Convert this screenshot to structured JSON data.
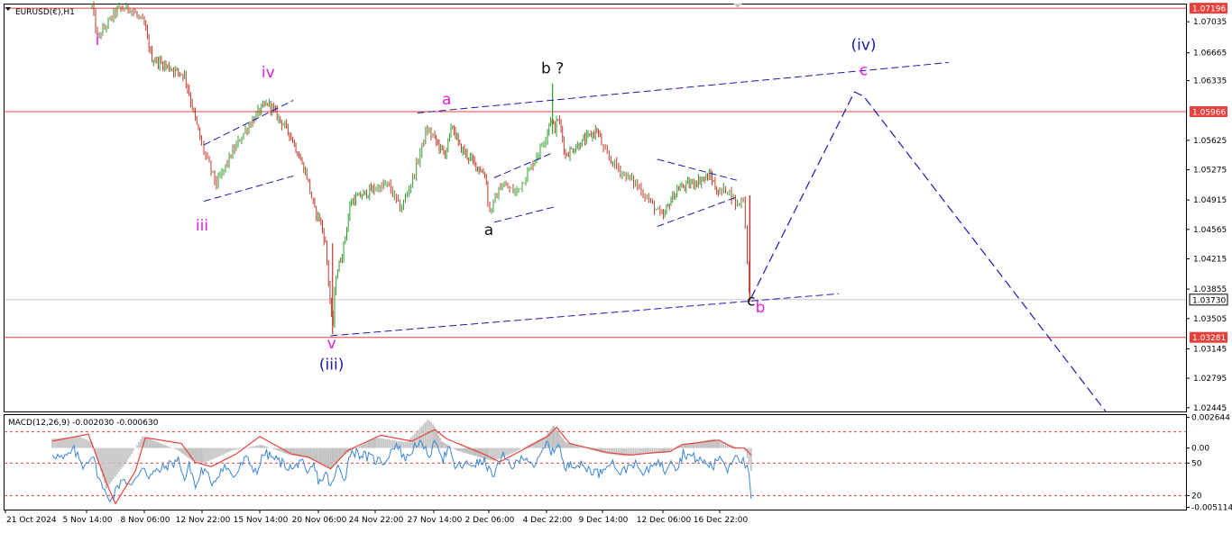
{
  "chart_data": [
    {
      "type": "candlestick",
      "title": "EURUSD(€),H1",
      "symbol": "EURUSD",
      "timeframe": "H1",
      "ylim": [
        1.024,
        1.0724
      ],
      "y_ticks": [
        "1.07035",
        "1.06665",
        "1.06335",
        "1.05625",
        "1.05275",
        "1.04915",
        "1.04565",
        "1.04215",
        "1.03855",
        "1.03505",
        "1.03145",
        "1.02795",
        "1.02445"
      ],
      "x_ticks": [
        "21 Oct 2024",
        "5 Nov 14:00",
        "8 Nov 06:00",
        "12 Nov 22:00",
        "15 Nov 14:00",
        "20 Nov 06:00",
        "24 Nov 22:00",
        "27 Nov 14:00",
        "2 Dec 06:00",
        "4 Dec 22:00",
        "9 Dec 14:00",
        "12 Dec 06:00",
        "16 Dec 22:00"
      ],
      "price_path": [
        {
          "x": "5 Nov 20:00",
          "y": 1.0722
        },
        {
          "x": "6 Nov 02:00",
          "y": 1.0684
        },
        {
          "x": "7 Nov 00:00",
          "y": 1.0718
        },
        {
          "x": "7 Nov 14:00",
          "y": 1.072
        },
        {
          "x": "8 Nov 06:00",
          "y": 1.07
        },
        {
          "x": "8 Nov 20:00",
          "y": 1.066
        },
        {
          "x": "11 Nov 12:00",
          "y": 1.064
        },
        {
          "x": "12 Nov 04:00",
          "y": 1.06
        },
        {
          "x": "12 Nov 22:00",
          "y": 1.0555
        },
        {
          "x": "13 Nov 14:00",
          "y": 1.051
        },
        {
          "x": "14 Nov 06:00",
          "y": 1.0545
        },
        {
          "x": "14 Nov 22:00",
          "y": 1.0575
        },
        {
          "x": "15 Nov 14:00",
          "y": 1.0598
        },
        {
          "x": "16 Nov 06:00",
          "y": 1.0607
        },
        {
          "x": "18 Nov 00:00",
          "y": 1.057
        },
        {
          "x": "18 Nov 16:00",
          "y": 1.0545
        },
        {
          "x": "19 Nov 08:00",
          "y": 1.052
        },
        {
          "x": "19 Nov 22:00",
          "y": 1.048
        },
        {
          "x": "20 Nov 08:00",
          "y": 1.047
        },
        {
          "x": "20 Nov 20:00",
          "y": 1.044
        },
        {
          "x": "21 Nov 10:00",
          "y": 1.0335
        },
        {
          "x": "21 Nov 16:00",
          "y": 1.04
        },
        {
          "x": "22 Nov 06:00",
          "y": 1.043
        },
        {
          "x": "22 Nov 22:00",
          "y": 1.049
        },
        {
          "x": "25 Nov 12:00",
          "y": 1.051
        },
        {
          "x": "26 Nov 02:00",
          "y": 1.048
        },
        {
          "x": "26 Nov 16:00",
          "y": 1.052
        },
        {
          "x": "27 Nov 06:00",
          "y": 1.0575
        },
        {
          "x": "27 Nov 20:00",
          "y": 1.056
        },
        {
          "x": "28 Nov 12:00",
          "y": 1.0545
        },
        {
          "x": "29 Nov 04:00",
          "y": 1.058
        },
        {
          "x": "29 Nov 18:00",
          "y": 1.0555
        },
        {
          "x": "2 Dec 00:00",
          "y": 1.052
        },
        {
          "x": "2 Dec 06:00",
          "y": 1.0475
        },
        {
          "x": "2 Dec 20:00",
          "y": 1.051
        },
        {
          "x": "3 Dec 12:00",
          "y": 1.05
        },
        {
          "x": "4 Dec 02:00",
          "y": 1.0525
        },
        {
          "x": "4 Dec 16:00",
          "y": 1.0555
        },
        {
          "x": "5 Dec 06:00",
          "y": 1.059
        },
        {
          "x": "5 Dec 14:00",
          "y": 1.0575
        },
        {
          "x": "5 Dec 22:00",
          "y": 1.059
        },
        {
          "x": "6 Dec 12:00",
          "y": 1.0545
        },
        {
          "x": "9 Dec 04:00",
          "y": 1.0575
        },
        {
          "x": "9 Dec 18:00",
          "y": 1.0545
        },
        {
          "x": "10 Dec 10:00",
          "y": 1.0525
        },
        {
          "x": "11 Dec 02:00",
          "y": 1.051
        },
        {
          "x": "11 Dec 16:00",
          "y": 1.049
        },
        {
          "x": "12 Dec 06:00",
          "y": 1.047
        },
        {
          "x": "12 Dec 20:00",
          "y": 1.049
        },
        {
          "x": "13 Dec 12:00",
          "y": 1.0505
        },
        {
          "x": "16 Dec 04:00",
          "y": 1.052
        },
        {
          "x": "16 Dec 18:00",
          "y": 1.05
        },
        {
          "x": "17 Dec 10:00",
          "y": 1.0505
        },
        {
          "x": "18 Dec 00:00",
          "y": 1.0485
        },
        {
          "x": "18 Dec 10:00",
          "y": 1.0495
        },
        {
          "x": "18 Dec 20:00",
          "y": 1.0373
        }
      ],
      "horizontal_levels": [
        {
          "price": 1.07196,
          "label": "1.07196",
          "color": "#e8413c"
        },
        {
          "price": 1.05966,
          "label": "1.05966",
          "color": "#e8413c"
        },
        {
          "price": 1.03281,
          "label": "1.03281",
          "color": "#e8413c"
        }
      ],
      "current_price": {
        "price": 1.0373,
        "label": "1.03730"
      },
      "trendlines": [
        {
          "from": [
            "21 Nov 06:00",
            1.033
          ],
          "to": [
            "24 Dec 12:00",
            1.038
          ]
        },
        {
          "from": [
            "26 Nov 20:00",
            1.0595
          ],
          "to": [
            "31 Dec 12:00",
            1.0655
          ]
        },
        {
          "from": [
            "13 Nov 00:00",
            1.0557
          ],
          "to": [
            "18 Nov 06:00",
            1.061
          ]
        },
        {
          "from": [
            "13 Nov 00:00",
            1.049
          ],
          "to": [
            "18 Nov 06:00",
            1.052
          ]
        },
        {
          "from": [
            "2 Dec 12:00",
            1.0518
          ],
          "to": [
            "5 Dec 12:00",
            1.0548
          ]
        },
        {
          "from": [
            "2 Dec 12:00",
            1.0465
          ],
          "to": [
            "5 Dec 12:00",
            1.0483
          ]
        },
        {
          "from": [
            "12 Dec 00:00",
            1.054
          ],
          "to": [
            "18 Dec 00:00",
            1.0515
          ]
        },
        {
          "from": [
            "12 Dec 00:00",
            1.046
          ],
          "to": [
            "18 Dec 00:00",
            1.0495
          ]
        }
      ],
      "projection": [
        {
          "x": "18 Dec 22:00",
          "y": 1.0375
        },
        {
          "x": "25 Dec 12:00",
          "y": 1.062
        },
        {
          "x": "26 Dec 02:00",
          "y": 1.0615
        },
        {
          "x": "10 Jan 12:00",
          "y": 1.024
        }
      ],
      "wave_labels": [
        {
          "text": "i",
          "x": "6 Nov 02:00",
          "y": 1.0676,
          "color": "#e81ee3"
        },
        {
          "text": "iii",
          "x": "12 Nov 22:00",
          "y": 1.0455,
          "color": "#e81ee3"
        },
        {
          "text": "iv",
          "x": "16 Nov 06:00",
          "y": 1.0637,
          "color": "#e81ee3"
        },
        {
          "text": "v",
          "x": "21 Nov 08:00",
          "y": 1.0315,
          "color": "#e81ee3"
        },
        {
          "text": "(iii)",
          "x": "21 Nov 08:00",
          "y": 1.029,
          "color": "#1919b4"
        },
        {
          "text": "a",
          "x": "28 Nov 16:00",
          "y": 1.0605,
          "color": "#e81ee3"
        },
        {
          "text": "a",
          "x": "2 Dec 06:00",
          "y": 1.045,
          "color": "#111111"
        },
        {
          "text": "b ?",
          "x": "5 Dec 10:00",
          "y": 1.0642,
          "color": "#111111"
        },
        {
          "text": "c",
          "x": "18 Dec 22:00",
          "y": 1.0366,
          "color": "#111111"
        },
        {
          "text": "b",
          "x": "19 Dec 12:00",
          "y": 1.0358,
          "color": "#e81ee3"
        },
        {
          "text": "(iv)",
          "x": "26 Dec 02:00",
          "y": 1.067,
          "color": "#1919b4"
        },
        {
          "text": "c",
          "x": "26 Dec 02:00",
          "y": 1.064,
          "color": "#e81ee3"
        }
      ]
    },
    {
      "type": "indicator",
      "title": "MACD(12,26,9) -0.002030 -0.000630",
      "name": "MACD(12,26,9)",
      "values_text": "-0.002030 -0.000630",
      "ylim": [
        -0.00531,
        0.00285
      ],
      "y_ticks": [
        {
          "label": "0.002644",
          "v": 0.002644
        },
        {
          "label": "0.00",
          "v": 0.0
        },
        {
          "label": "50",
          "v": -0.0013
        },
        {
          "label": "20",
          "v": -0.0041
        },
        {
          "label": "-0.005114",
          "v": -0.005114
        }
      ],
      "levels": [
        0.0014,
        -0.0013,
        -0.0041
      ],
      "histogram": [
        {
          "x": "4 Nov 00:00",
          "y": 0.0008
        },
        {
          "x": "5 Nov 06:00",
          "y": 0.001
        },
        {
          "x": "5 Nov 20:00",
          "y": 0.0005
        },
        {
          "x": "6 Nov 12:00",
          "y": -0.0035
        },
        {
          "x": "7 Nov 12:00",
          "y": -0.001
        },
        {
          "x": "8 Nov 04:00",
          "y": 0.001
        },
        {
          "x": "11 Nov 00:00",
          "y": -0.0002
        },
        {
          "x": "12 Nov 00:00",
          "y": -0.001
        },
        {
          "x": "13 Nov 00:00",
          "y": -0.0013
        },
        {
          "x": "14 Nov 08:00",
          "y": -0.0002
        },
        {
          "x": "15 Nov 16:00",
          "y": 0.0003
        },
        {
          "x": "18 Nov 00:00",
          "y": -0.0006
        },
        {
          "x": "19 Nov 08:00",
          "y": -0.0008
        },
        {
          "x": "21 Nov 06:00",
          "y": -0.0018
        },
        {
          "x": "22 Nov 06:00",
          "y": -0.0006
        },
        {
          "x": "25 Nov 00:00",
          "y": 0.0009
        },
        {
          "x": "26 Nov 08:00",
          "y": 0.0005
        },
        {
          "x": "27 Nov 08:00",
          "y": 0.0025
        },
        {
          "x": "28 Nov 06:00",
          "y": 0.0006
        },
        {
          "x": "29 Nov 12:00",
          "y": -0.0002
        },
        {
          "x": "2 Dec 12:00",
          "y": -0.0011
        },
        {
          "x": "3 Dec 12:00",
          "y": -0.0003
        },
        {
          "x": "4 Dec 20:00",
          "y": 0.001
        },
        {
          "x": "5 Dec 12:00",
          "y": 0.002
        },
        {
          "x": "6 Dec 12:00",
          "y": 0.0005
        },
        {
          "x": "9 Dec 12:00",
          "y": -0.0004
        },
        {
          "x": "10 Dec 12:00",
          "y": -0.0007
        },
        {
          "x": "11 Dec 12:00",
          "y": -0.0005
        },
        {
          "x": "12 Dec 12:00",
          "y": -0.0004
        },
        {
          "x": "13 Dec 12:00",
          "y": 0.0002
        },
        {
          "x": "16 Dec 12:00",
          "y": 0.0008
        },
        {
          "x": "17 Dec 12:00",
          "y": 0.0003
        },
        {
          "x": "18 Dec 12:00",
          "y": -0.0001
        },
        {
          "x": "18 Dec 22:00",
          "y": -0.002
        }
      ],
      "signal": [
        {
          "x": "4 Nov 00:00",
          "y": 0.0006
        },
        {
          "x": "5 Nov 16:00",
          "y": 0.0012
        },
        {
          "x": "6 Nov 12:00",
          "y": -0.003
        },
        {
          "x": "6 Nov 22:00",
          "y": -0.0048
        },
        {
          "x": "7 Nov 20:00",
          "y": -0.002
        },
        {
          "x": "8 Nov 08:00",
          "y": 0.0009
        },
        {
          "x": "11 Nov 06:00",
          "y": 0.0004
        },
        {
          "x": "12 Nov 08:00",
          "y": -0.0012
        },
        {
          "x": "13 Nov 08:00",
          "y": -0.0016
        },
        {
          "x": "14 Nov 12:00",
          "y": -0.0005
        },
        {
          "x": "15 Nov 14:00",
          "y": 0.001
        },
        {
          "x": "18 Nov 02:00",
          "y": -0.0005
        },
        {
          "x": "19 Nov 12:00",
          "y": -0.0008
        },
        {
          "x": "21 Nov 06:00",
          "y": -0.0018
        },
        {
          "x": "22 Nov 16:00",
          "y": -0.0002
        },
        {
          "x": "25 Nov 04:00",
          "y": 0.0011
        },
        {
          "x": "26 Nov 14:00",
          "y": 0.0006
        },
        {
          "x": "27 Nov 16:00",
          "y": 0.0016
        },
        {
          "x": "28 Nov 16:00",
          "y": 0.0008
        },
        {
          "x": "2 Dec 00:00",
          "y": -0.0006
        },
        {
          "x": "2 Dec 18:00",
          "y": -0.0012
        },
        {
          "x": "3 Dec 16:00",
          "y": -0.0003
        },
        {
          "x": "5 Dec 00:00",
          "y": 0.001
        },
        {
          "x": "5 Dec 18:00",
          "y": 0.0018
        },
        {
          "x": "6 Dec 20:00",
          "y": 0.0004
        },
        {
          "x": "9 Dec 20:00",
          "y": -0.0004
        },
        {
          "x": "10 Dec 20:00",
          "y": -0.0006
        },
        {
          "x": "11 Dec 20:00",
          "y": -0.0004
        },
        {
          "x": "12 Dec 20:00",
          "y": -0.0003
        },
        {
          "x": "13 Dec 20:00",
          "y": 0.0003
        },
        {
          "x": "16 Dec 20:00",
          "y": 0.0007
        },
        {
          "x": "17 Dec 20:00",
          "y": 0.0
        },
        {
          "x": "18 Dec 12:00",
          "y": 0.0
        },
        {
          "x": "18 Dec 22:00",
          "y": -0.0006
        }
      ],
      "oscillator": [
        {
          "x": "4 Nov 00:00",
          "y": -0.0004
        },
        {
          "x": "4 Nov 12:00",
          "y": -0.001
        },
        {
          "x": "5 Nov 00:00",
          "y": -0.0002
        },
        {
          "x": "5 Nov 10:00",
          "y": -0.0015
        },
        {
          "x": "5 Nov 20:00",
          "y": -0.0006
        },
        {
          "x": "6 Nov 08:00",
          "y": -0.0036
        },
        {
          "x": "6 Nov 18:00",
          "y": -0.0044
        },
        {
          "x": "7 Nov 06:00",
          "y": -0.0025
        },
        {
          "x": "7 Nov 16:00",
          "y": -0.0034
        },
        {
          "x": "8 Nov 04:00",
          "y": -0.0015
        },
        {
          "x": "8 Nov 14:00",
          "y": -0.0024
        },
        {
          "x": "11 Nov 02:00",
          "y": -0.001
        },
        {
          "x": "11 Nov 12:00",
          "y": -0.0028
        },
        {
          "x": "11 Nov 22:00",
          "y": -0.0014
        },
        {
          "x": "12 Nov 10:00",
          "y": -0.0035
        },
        {
          "x": "12 Nov 22:00",
          "y": -0.0018
        },
        {
          "x": "13 Nov 10:00",
          "y": -0.003
        },
        {
          "x": "13 Nov 22:00",
          "y": -0.0015
        },
        {
          "x": "14 Nov 10:00",
          "y": -0.0025
        },
        {
          "x": "14 Nov 22:00",
          "y": -0.0009
        },
        {
          "x": "15 Nov 10:00",
          "y": -0.002
        },
        {
          "x": "15 Nov 22:00",
          "y": -0.0004
        },
        {
          "x": "18 Nov 08:00",
          "y": -0.0019
        },
        {
          "x": "18 Nov 20:00",
          "y": -0.0008
        },
        {
          "x": "19 Nov 08:00",
          "y": -0.0026
        },
        {
          "x": "19 Nov 20:00",
          "y": -0.0014
        },
        {
          "x": "20 Nov 08:00",
          "y": -0.003
        },
        {
          "x": "20 Nov 20:00",
          "y": -0.0022
        },
        {
          "x": "21 Nov 08:00",
          "y": -0.0034
        },
        {
          "x": "21 Nov 20:00",
          "y": -0.0016
        },
        {
          "x": "22 Nov 10:00",
          "y": -0.0026
        },
        {
          "x": "22 Nov 22:00",
          "y": -0.0002
        },
        {
          "x": "25 Nov 08:00",
          "y": -0.0012
        },
        {
          "x": "25 Nov 20:00",
          "y": 0.0004
        },
        {
          "x": "26 Nov 08:00",
          "y": -0.001
        },
        {
          "x": "26 Nov 20:00",
          "y": 0.0006
        },
        {
          "x": "27 Nov 08:00",
          "y": -0.0006
        },
        {
          "x": "27 Nov 20:00",
          "y": 0.0008
        },
        {
          "x": "28 Nov 08:00",
          "y": -0.001
        },
        {
          "x": "28 Nov 20:00",
          "y": 0.0
        },
        {
          "x": "29 Nov 08:00",
          "y": -0.0016
        },
        {
          "x": "2 Dec 00:00",
          "y": -0.0012
        },
        {
          "x": "2 Dec 10:00",
          "y": -0.0024
        },
        {
          "x": "2 Dec 22:00",
          "y": -0.0008
        },
        {
          "x": "3 Dec 10:00",
          "y": -0.0016
        },
        {
          "x": "3 Dec 22:00",
          "y": -0.0006
        },
        {
          "x": "4 Dec 10:00",
          "y": -0.0016
        },
        {
          "x": "4 Dec 22:00",
          "y": 0.0004
        },
        {
          "x": "5 Dec 10:00",
          "y": -0.0004
        },
        {
          "x": "5 Dec 22:00",
          "y": 0.0006
        },
        {
          "x": "6 Dec 10:00",
          "y": -0.002
        },
        {
          "x": "6 Dec 22:00",
          "y": -0.0012
        },
        {
          "x": "9 Dec 10:00",
          "y": -0.0022
        },
        {
          "x": "9 Dec 22:00",
          "y": -0.001
        },
        {
          "x": "10 Dec 10:00",
          "y": -0.0022
        },
        {
          "x": "10 Dec 22:00",
          "y": -0.0012
        },
        {
          "x": "11 Dec 10:00",
          "y": -0.0024
        },
        {
          "x": "11 Dec 22:00",
          "y": -0.001
        },
        {
          "x": "12 Dec 10:00",
          "y": -0.002
        },
        {
          "x": "12 Dec 22:00",
          "y": -0.0008
        },
        {
          "x": "13 Dec 10:00",
          "y": -0.0018
        },
        {
          "x": "13 Dec 22:00",
          "y": -0.0004
        },
        {
          "x": "16 Dec 10:00",
          "y": -0.0016
        },
        {
          "x": "16 Dec 22:00",
          "y": -0.0006
        },
        {
          "x": "17 Dec 10:00",
          "y": -0.0018
        },
        {
          "x": "17 Dec 22:00",
          "y": -0.0004
        },
        {
          "x": "18 Dec 10:00",
          "y": -0.0012
        },
        {
          "x": "18 Dec 18:00",
          "y": -0.002
        },
        {
          "x": "18 Dec 22:00",
          "y": -0.0046
        }
      ]
    }
  ],
  "colors": {
    "bull_candle": "#2e9e2e",
    "bear_candle": "#c0392b",
    "level_line": "#e8413c",
    "trend_line": "#1919b4",
    "wave_pink": "#e81ee3",
    "wave_blue": "#1919b4",
    "macd_hist": "#c0c0c0",
    "macd_signal": "#e8413c",
    "osc_line": "#3a86d6",
    "grid_level": "#e8413c"
  }
}
